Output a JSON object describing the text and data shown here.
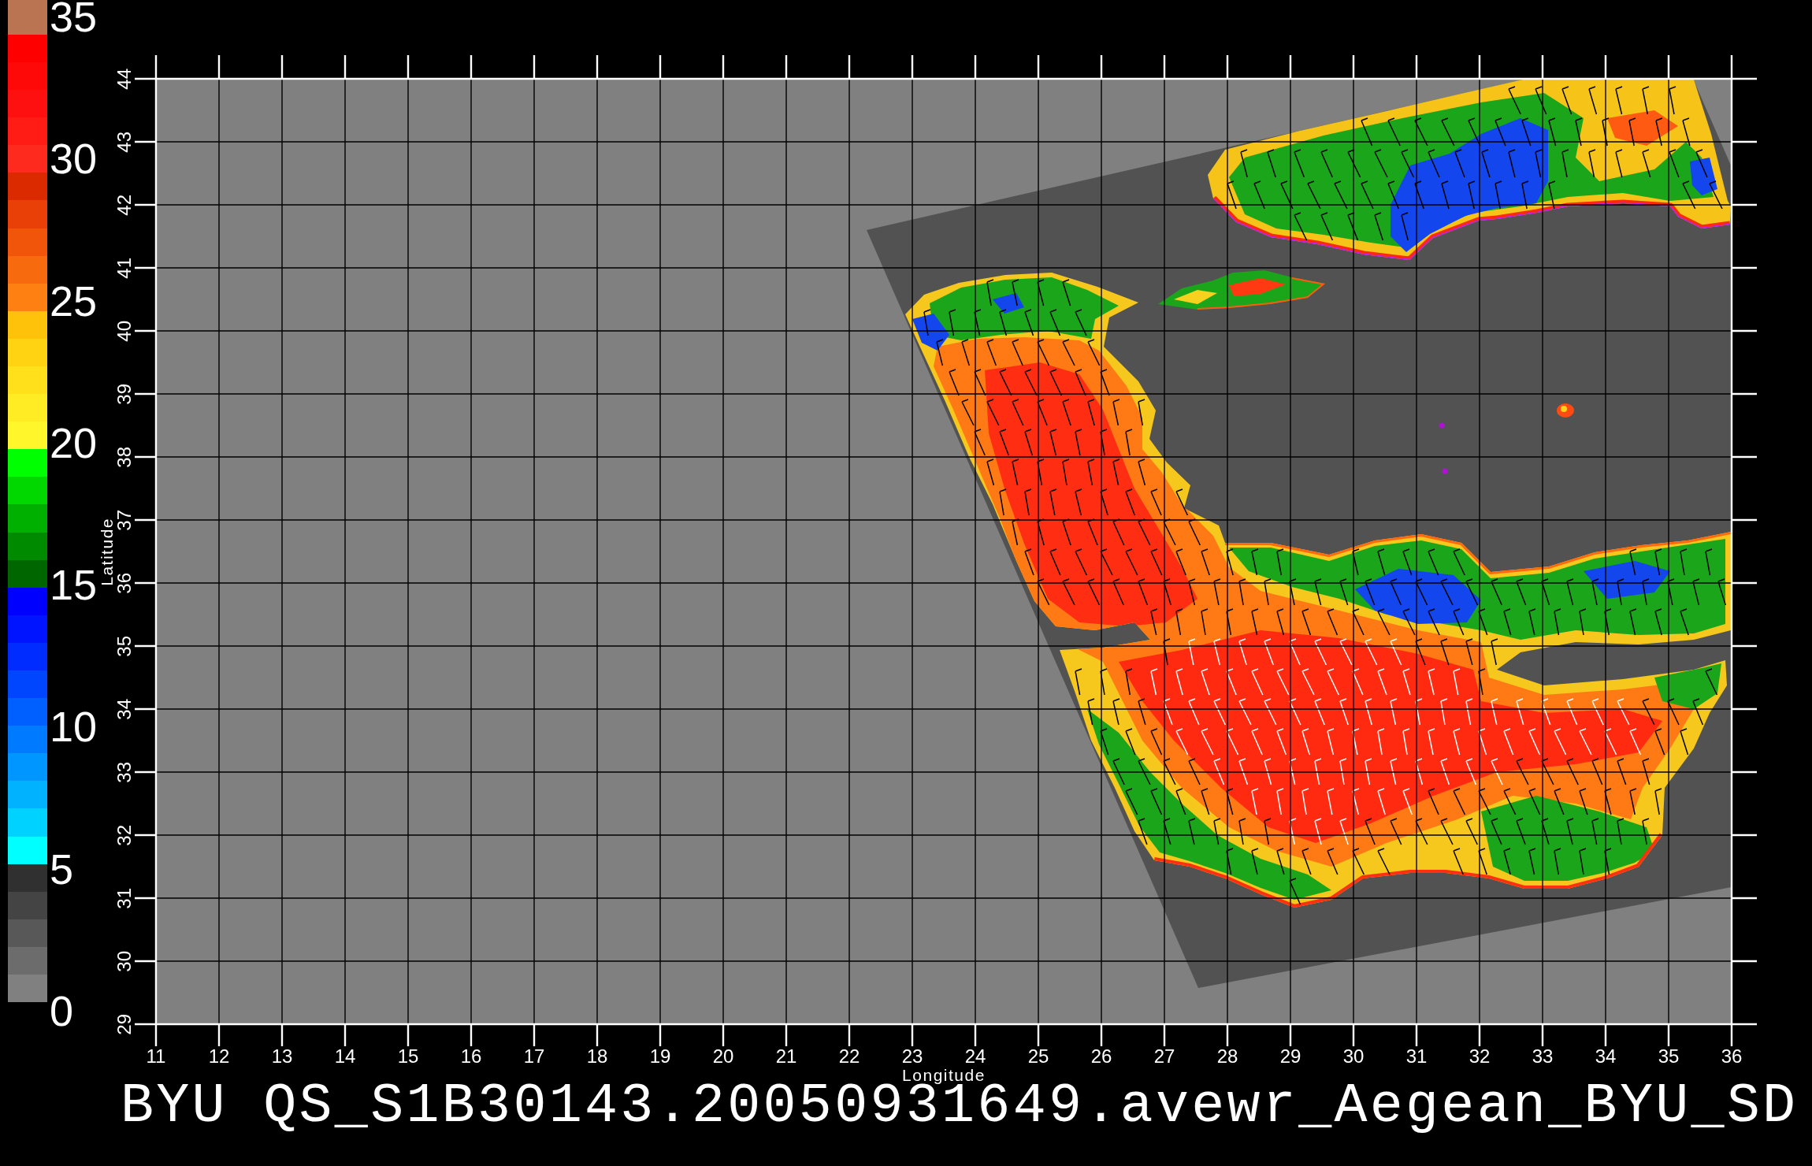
{
  "colorbar": {
    "stripes": [
      {
        "color": "#bb7452"
      },
      {
        "color": "#ff0000"
      },
      {
        "color": "#ff0808"
      },
      {
        "color": "#ff1010"
      },
      {
        "color": "#ff1c14"
      },
      {
        "color": "#ff2a1e"
      },
      {
        "color": "#dc2a00"
      },
      {
        "color": "#e84006"
      },
      {
        "color": "#f0550a"
      },
      {
        "color": "#f86a0e"
      },
      {
        "color": "#ff8012"
      },
      {
        "color": "#ffc20a"
      },
      {
        "color": "#ffd212"
      },
      {
        "color": "#ffe01a"
      },
      {
        "color": "#ffec24"
      },
      {
        "color": "#fff62c"
      },
      {
        "color": "#00ff00"
      },
      {
        "color": "#00d800"
      },
      {
        "color": "#00b000"
      },
      {
        "color": "#008a00"
      },
      {
        "color": "#006600"
      },
      {
        "color": "#0000ff"
      },
      {
        "color": "#0014ff"
      },
      {
        "color": "#002cff"
      },
      {
        "color": "#0046ff"
      },
      {
        "color": "#0060ff"
      },
      {
        "color": "#007aff"
      },
      {
        "color": "#0096ff"
      },
      {
        "color": "#00b2ff"
      },
      {
        "color": "#00d2ff"
      },
      {
        "color": "#00ffff"
      },
      {
        "color": "#303030"
      },
      {
        "color": "#444444"
      },
      {
        "color": "#585858"
      },
      {
        "color": "#6c6c6c"
      },
      {
        "color": "#808080"
      }
    ],
    "ticks": [
      "35",
      "30",
      "25",
      "20",
      "15",
      "10",
      "5",
      "0"
    ]
  },
  "plot": {
    "y_axis": {
      "label": "Latitude",
      "ticks": [
        "44",
        "43",
        "42",
        "41",
        "40",
        "39",
        "38",
        "37",
        "36",
        "35",
        "34",
        "33",
        "32",
        "31",
        "30",
        "29"
      ]
    },
    "x_axis": {
      "label": "Longitude",
      "ticks": [
        "11",
        "12",
        "13",
        "14",
        "15",
        "16",
        "17",
        "18",
        "19",
        "20",
        "21",
        "22",
        "23",
        "24",
        "25",
        "26",
        "27",
        "28",
        "29",
        "30",
        "31",
        "32",
        "33",
        "34",
        "35",
        "36"
      ]
    }
  },
  "title": "BYU QS_S1B30143.20050931649.avewr_Aegean_BYU_SD"
}
